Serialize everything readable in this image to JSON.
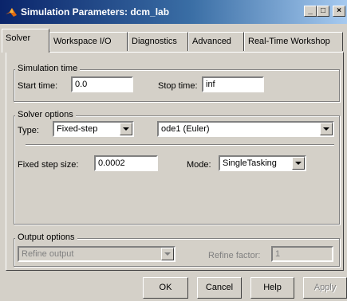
{
  "window": {
    "title": "Simulation Parameters: dcm_lab",
    "minimize": "_",
    "maximize": "□",
    "close": "×"
  },
  "tabs": [
    "Solver",
    "Workspace I/O",
    "Diagnostics",
    "Advanced",
    "Real-Time Workshop"
  ],
  "simulation_time": {
    "group_title": "Simulation time",
    "start_label": "Start time:",
    "start_value": "0.0",
    "stop_label": "Stop time:",
    "stop_value": "inf"
  },
  "solver_options": {
    "group_title": "Solver options",
    "type_label": "Type:",
    "type_value": "Fixed-step",
    "solver_value": "ode1 (Euler)",
    "step_label": "Fixed step size:",
    "step_value": "0.0002",
    "mode_label": "Mode:",
    "mode_value": "SingleTasking"
  },
  "output_options": {
    "group_title": "Output options",
    "output_value": "Refine output",
    "refine_label": "Refine factor:",
    "refine_value": "1"
  },
  "buttons": {
    "ok": "OK",
    "cancel": "Cancel",
    "help": "Help",
    "apply": "Apply"
  },
  "colors": {
    "titlebar_start": "#0a246a",
    "titlebar_end": "#a6caf0",
    "face": "#d4d0c8"
  }
}
